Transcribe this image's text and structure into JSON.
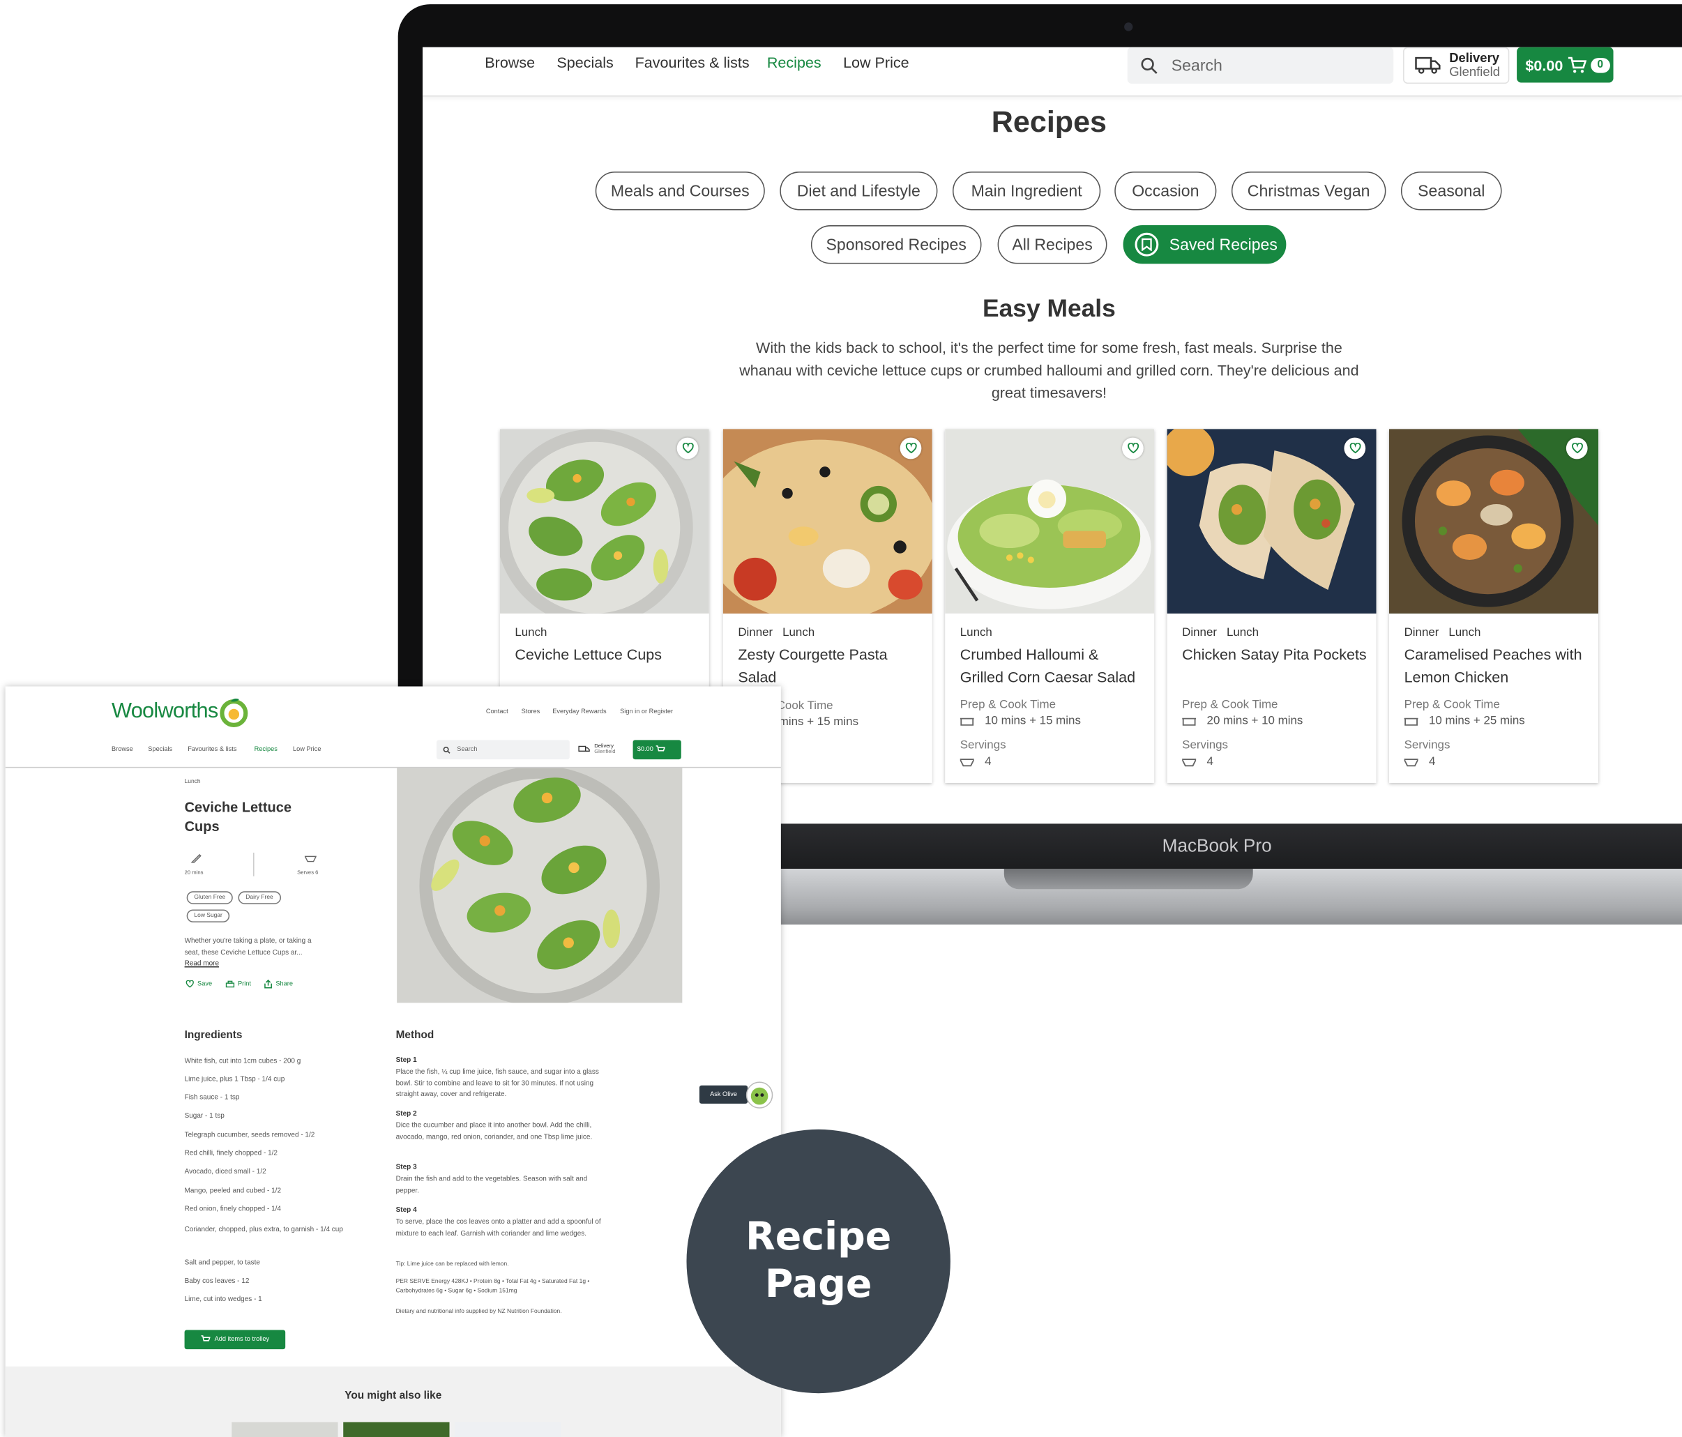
{
  "laptop": {
    "brand_label": "MacBook Pro",
    "nav": {
      "links": [
        "Browse",
        "Specials",
        "Favourites & lists",
        "Recipes",
        "Low Price"
      ],
      "active": "Recipes",
      "search_placeholder": "Search",
      "delivery_label": "Delivery",
      "delivery_location": "Glenfield",
      "cart_total": "$0.00",
      "cart_count": "0"
    },
    "recipes": {
      "title": "Recipes",
      "categories_row1": [
        "Meals and Courses",
        "Diet and Lifestyle",
        "Main Ingredient",
        "Occasion",
        "Christmas Vegan",
        "Seasonal"
      ],
      "categories_row2": [
        "Sponsored Recipes",
        "All Recipes",
        "Saved Recipes"
      ],
      "section_title": "Easy Meals",
      "section_description": "With the kids back to school, it's the perfect time for some fresh, fast meals. Surprise the whanau with ceviche lettuce cups or crumbed halloumi and grilled corn. They're delicious and great timesavers!",
      "cards": [
        {
          "tags": "Lunch",
          "title": "Ceviche Lettuce Cups",
          "time_label": "",
          "time": "",
          "servings_label": "",
          "servings": ""
        },
        {
          "tags": "Dinner Lunch",
          "title": "Zesty Courgette Pasta Salad",
          "time_label": "Cook Time",
          "time": "mins + 15 mins",
          "servings_label": "",
          "servings": ""
        },
        {
          "tags": "Lunch",
          "title": "Crumbed Halloumi & Grilled Corn Caesar Salad",
          "time_label": "Prep & Cook Time",
          "time": "10 mins + 15 mins",
          "servings_label": "Servings",
          "servings": "4"
        },
        {
          "tags": "Dinner Lunch",
          "title": "Chicken Satay Pita Pockets",
          "time_label": "Prep & Cook Time",
          "time": "20 mins + 10 mins",
          "servings_label": "Servings",
          "servings": "4"
        },
        {
          "tags": "Dinner Lunch",
          "title": "Caramelised Peaches with Lemon Chicken",
          "time_label": "Prep & Cook Time",
          "time": "10 mins + 25 mins",
          "servings_label": "Servings",
          "servings": "4"
        }
      ]
    }
  },
  "recipe_page": {
    "logo_text": "Woolworths",
    "top_links": [
      "Contact",
      "Stores",
      "Everyday Rewards",
      "Sign in or Register"
    ],
    "nav_links": [
      "Browse",
      "Specials",
      "Favourites & lists",
      "Recipes",
      "Low Price"
    ],
    "search_placeholder": "Search",
    "delivery_label": "Delivery",
    "delivery_location": "Glenfield",
    "cart_total": "$0.00",
    "category": "Lunch",
    "title": "Ceviche Lettuce Cups",
    "time": "20 mins",
    "serves": "Serves 6",
    "diet_tags": [
      "Gluten Free",
      "Dairy Free",
      "Low Sugar"
    ],
    "description": "Whether you're taking a plate, or taking a seat, these Ceviche Lettuce Cups ar...",
    "read_more": "Read more",
    "actions": [
      "Save",
      "Print",
      "Share"
    ],
    "ingredients_title": "Ingredients",
    "ingredients": [
      "White fish, cut into 1cm cubes - 200 g",
      "Lime juice, plus 1 Tbsp - 1/4 cup",
      "Fish sauce - 1 tsp",
      "Sugar - 1 tsp",
      "Telegraph cucumber, seeds removed - 1/2",
      "Red chilli, finely chopped - 1/2",
      "Avocado, diced small - 1/2",
      "Mango, peeled and cubed - 1/2",
      "Red onion, finely chopped - 1/4",
      "Coriander, chopped, plus extra, to garnish - 1/4 cup",
      "Salt and pepper, to taste",
      "Baby cos leaves - 12",
      "Lime, cut into wedges - 1"
    ],
    "add_to_trolley": "Add items to trolley",
    "method_title": "Method",
    "steps": [
      {
        "label": "Step 1",
        "text": "Place the fish, ¼ cup lime juice, fish sauce, and sugar into a glass bowl. Stir to combine and leave to sit for 30 minutes. If not using straight away, cover and refrigerate."
      },
      {
        "label": "Step 2",
        "text": "Dice the cucumber and place it into another bowl. Add the chilli, avocado, mango, red onion, coriander, and one Tbsp lime juice."
      },
      {
        "label": "Step 3",
        "text": "Drain the fish and add to the vegetables. Season with salt and pepper."
      },
      {
        "label": "Step 4",
        "text": "To serve, place the cos leaves onto a platter and add a spoonful of mixture to each leaf. Garnish with coriander and lime wedges."
      }
    ],
    "tip": "Tip: Lime juice can be replaced with lemon.",
    "nutrition": "PER SERVE Energy 428KJ • Protein 8g • Total Fat 4g • Saturated Fat 1g • Carbohydrates 6g • Sugar 6g • Sodium 151mg",
    "nutrition_source": "Dietary and nutritional info supplied by NZ Nutrition Foundation.",
    "ask_olive": "Ask Olive",
    "you_might_also_like": "You might also like"
  },
  "callout": {
    "line1": "Recipe",
    "line2": "Page"
  },
  "colors": {
    "brand_green": "#178841",
    "callout_bg": "#3c4650"
  }
}
